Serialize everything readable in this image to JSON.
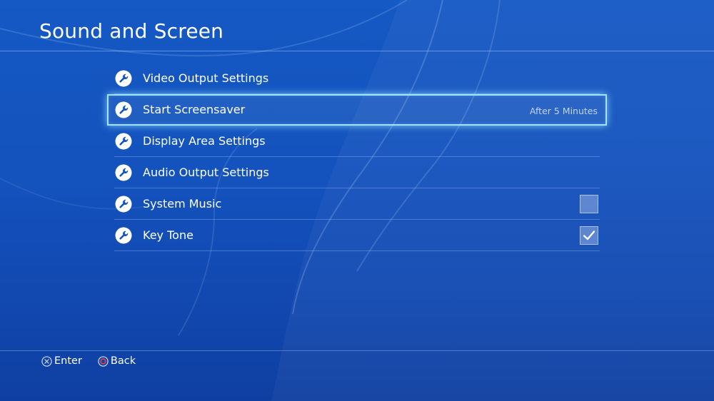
{
  "screen": {
    "title": "Sound and Screen"
  },
  "menu": {
    "items": [
      {
        "label": "Video Output Settings",
        "icon": "wrench-icon"
      },
      {
        "label": "Start Screensaver",
        "value": "After 5 Minutes",
        "icon": "wrench-icon",
        "selected": true
      },
      {
        "label": "Display Area Settings",
        "icon": "wrench-icon"
      },
      {
        "label": "Audio Output Settings",
        "icon": "wrench-icon"
      },
      {
        "label": "System Music",
        "icon": "wrench-icon",
        "checked": false
      },
      {
        "label": "Key Tone",
        "icon": "wrench-icon",
        "checked": true
      }
    ]
  },
  "footer": {
    "enter": {
      "label": "Enter",
      "icon": "cross-button-icon"
    },
    "back": {
      "label": "Back",
      "icon": "circle-button-icon"
    }
  },
  "colors": {
    "background": "#1452bd",
    "highlight": "#9fe3ff",
    "circle_button": "#e3403f"
  }
}
